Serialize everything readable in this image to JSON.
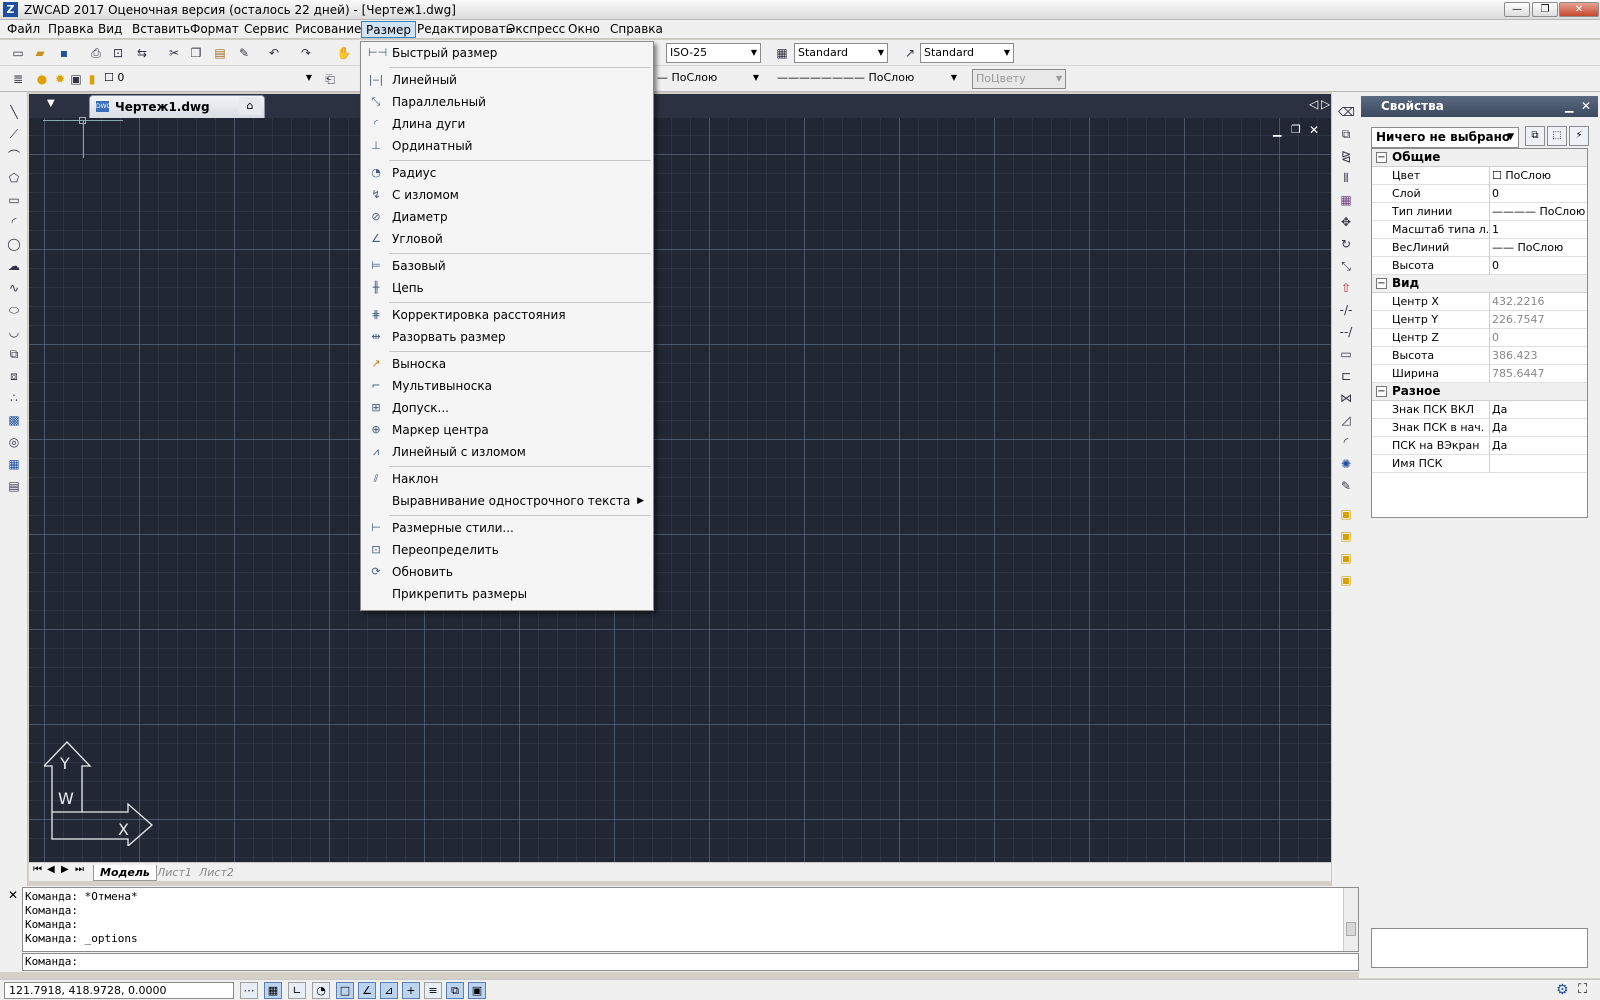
{
  "window": {
    "title": "ZWCAD 2017 Оценочная версия (осталось 22 дней) - [Чертеж1.dwg]",
    "app_icon": "Z"
  },
  "menubar": [
    "Файл",
    "Правка",
    "Вид",
    "Вставить",
    "Формат",
    "Сервис",
    "Рисование",
    "Размер",
    "Редактировать",
    "Экспресс",
    "Окно",
    "Справка"
  ],
  "active_menu": "Размер",
  "toolbar": {
    "dimstyle": "ISO-25",
    "tablestyle": "Standard",
    "mleaderstyle": "Standard",
    "layer": "0",
    "linetype": "ПоСлою",
    "lineweight": "ПоСлою",
    "plotstyle": "ПоЦвету"
  },
  "document_tab": {
    "label": "Чертеж1.dwg",
    "close": "✕"
  },
  "dropdown": {
    "items": [
      {
        "label": "Быстрый размер",
        "icon": "quick-dim-icon"
      },
      {
        "label": "Линейный",
        "icon": "linear-dim-icon"
      },
      {
        "label": "Параллельный",
        "icon": "aligned-dim-icon"
      },
      {
        "label": "Длина дуги",
        "icon": "arc-length-icon"
      },
      {
        "label": "Ординатный",
        "icon": "ordinate-icon"
      },
      {
        "label": "Радиус",
        "icon": "radius-icon"
      },
      {
        "label": "С изломом",
        "icon": "jogged-icon"
      },
      {
        "label": "Диаметр",
        "icon": "diameter-icon"
      },
      {
        "label": "Угловой",
        "icon": "angular-icon"
      },
      {
        "label": "Базовый",
        "icon": "baseline-icon"
      },
      {
        "label": "Цепь",
        "icon": "continue-icon"
      },
      {
        "label": "Корректировка расстояния",
        "icon": "space-icon"
      },
      {
        "label": "Разорвать размер",
        "icon": "break-icon"
      },
      {
        "label": "Выноска",
        "icon": "leader-icon"
      },
      {
        "label": "Мультивыноска",
        "icon": "mleader-icon"
      },
      {
        "label": "Допуск...",
        "icon": "tolerance-icon"
      },
      {
        "label": "Маркер центра",
        "icon": "center-mark-icon"
      },
      {
        "label": "Линейный с изломом",
        "icon": "jogged-linear-icon"
      },
      {
        "label": "Наклон",
        "icon": "oblique-icon"
      },
      {
        "label": "Выравнивание однострочного текста",
        "icon": "",
        "submenu": "▶"
      },
      {
        "label": "Размерные стили...",
        "icon": "dimstyle-icon"
      },
      {
        "label": "Переопределить",
        "icon": "override-icon"
      },
      {
        "label": "Обновить",
        "icon": "update-icon"
      },
      {
        "label": "Прикрепить размеры",
        "icon": ""
      }
    ]
  },
  "ucs": {
    "y": "Y",
    "x": "X",
    "w": "W"
  },
  "layout_tabs": [
    "Модель",
    "Лист1",
    "Лист2"
  ],
  "command": {
    "history": [
      "Команда: *Отмена*",
      "Команда:",
      "Команда:",
      "Команда: _options"
    ],
    "prompt": "Команда:"
  },
  "status": {
    "coords": "121.7918, 418.9728, 0.0000"
  },
  "properties": {
    "title": "Свойства",
    "selection": "Ничего не выбрано",
    "categories": [
      {
        "name": "Общие",
        "rows": [
          {
            "k": "Цвет",
            "v": "☐ ПоСлою"
          },
          {
            "k": "Слой",
            "v": "0"
          },
          {
            "k": "Тип линии",
            "v": "———— ПоСлою"
          },
          {
            "k": "Масштаб типа л...",
            "v": "1"
          },
          {
            "k": "ВесЛиний",
            "v": "—— ПоСлою"
          },
          {
            "k": "Высота",
            "v": "0"
          }
        ]
      },
      {
        "name": "Вид",
        "rows": [
          {
            "k": "Центр X",
            "v": "432.2216"
          },
          {
            "k": "Центр Y",
            "v": "226.7547"
          },
          {
            "k": "Центр Z",
            "v": "0"
          },
          {
            "k": "Высота",
            "v": "386.423"
          },
          {
            "k": "Ширина",
            "v": "785.6447"
          }
        ]
      },
      {
        "name": "Разное",
        "rows": [
          {
            "k": "Знак ПСК ВКЛ",
            "v": "Да"
          },
          {
            "k": "Знак ПСК в нач. ...",
            "v": "Да"
          },
          {
            "k": "ПСК на ВЭкран",
            "v": "Да"
          },
          {
            "k": "Имя ПСК",
            "v": ""
          }
        ]
      }
    ]
  }
}
